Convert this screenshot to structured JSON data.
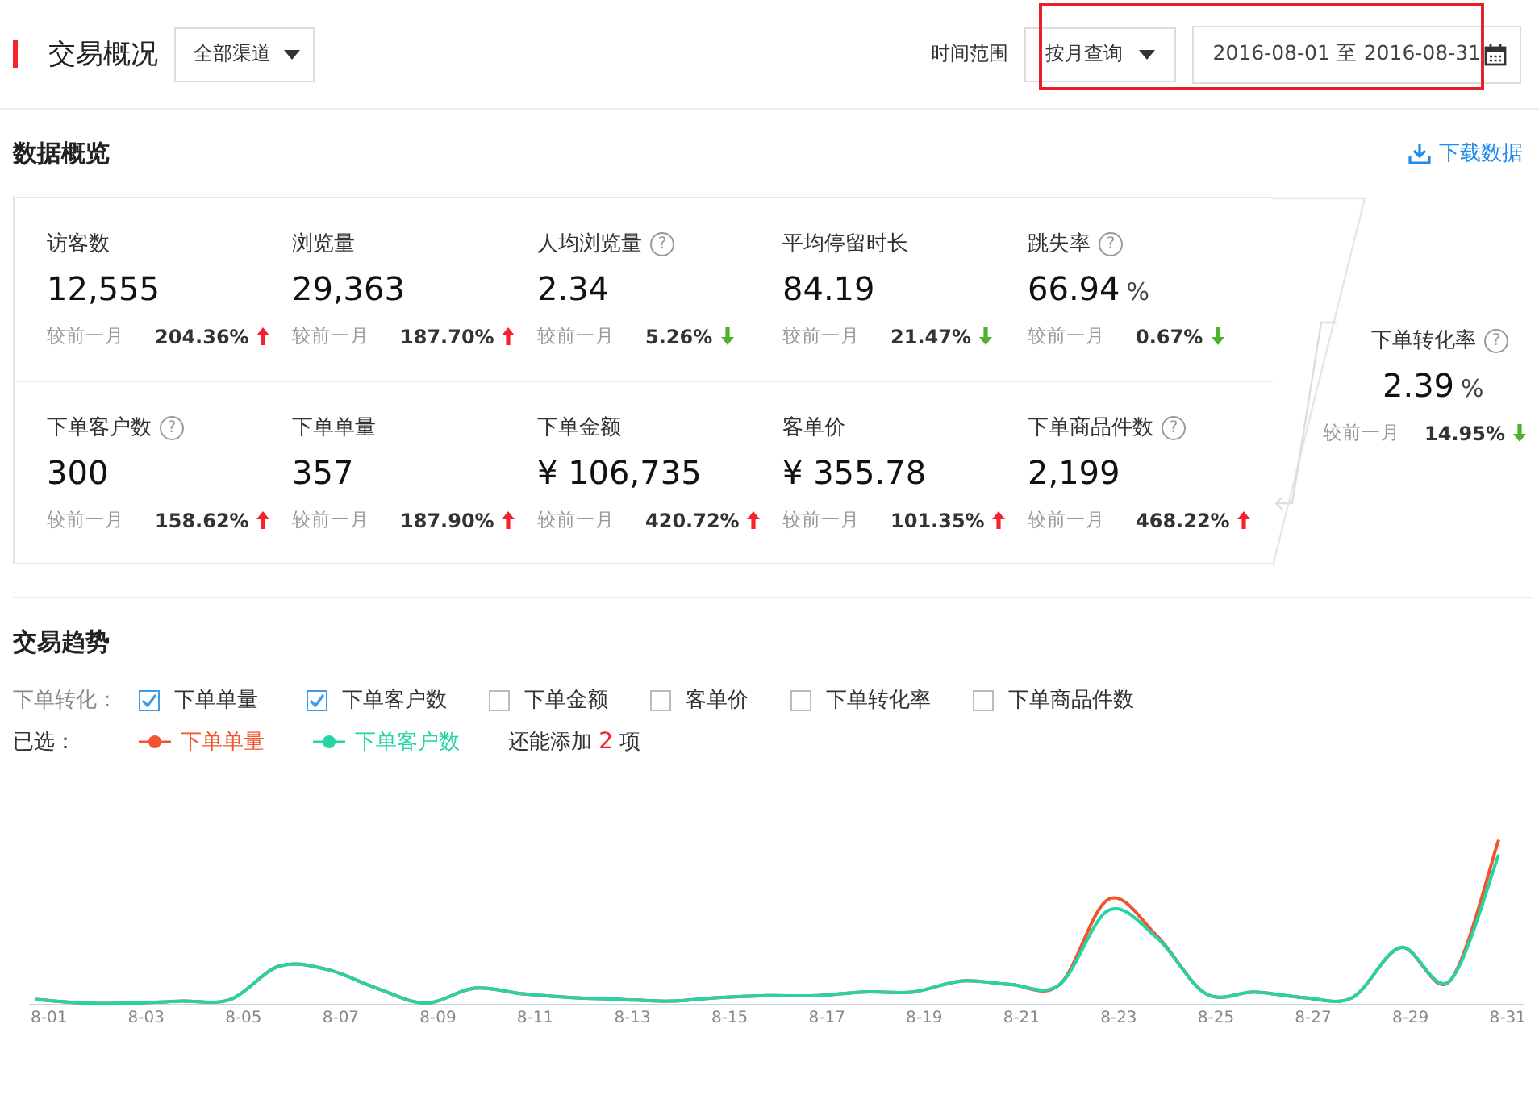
{
  "header": {
    "title": "交易概况",
    "channel": "全部渠道",
    "range_label": "时间范围",
    "range_mode": "按月查询",
    "date_range": "2016-08-01 至 2016-08-31"
  },
  "overview": {
    "title": "数据概览",
    "download": "下载数据",
    "metrics": [
      {
        "label": "访客数",
        "value": "12,555",
        "compare": "较前一月",
        "change": "204.36%",
        "increase": true
      },
      {
        "label": "浏览量",
        "value": "29,363",
        "compare": "较前一月",
        "change": "187.70%",
        "increase": true
      },
      {
        "label": "人均浏览量",
        "help": "?",
        "value": "2.34",
        "compare": "较前一月",
        "change": "5.26%",
        "increase": false
      },
      {
        "label": "平均停留时长",
        "value": "84.19",
        "compare": "较前一月",
        "change": "21.47%",
        "increase": false
      },
      {
        "label": "跳失率",
        "help": "?",
        "value": "66.94",
        "unit": "%",
        "compare": "较前一月",
        "change": "0.67%",
        "increase": false
      },
      {
        "label": "下单客户数",
        "help": "?",
        "value": "300",
        "compare": "较前一月",
        "change": "158.62%",
        "increase": true
      },
      {
        "label": "下单单量",
        "value": "357",
        "compare": "较前一月",
        "change": "187.90%",
        "increase": true
      },
      {
        "label": "下单金额",
        "value": "¥ 106,735",
        "compare": "较前一月",
        "change": "420.72%",
        "increase": true
      },
      {
        "label": "客单价",
        "value": "¥ 355.78",
        "compare": "较前一月",
        "change": "101.35%",
        "increase": true
      },
      {
        "label": "下单商品件数",
        "help": "?",
        "value": "2,199",
        "compare": "较前一月",
        "change": "468.22%",
        "increase": true
      }
    ],
    "conversion": {
      "label": "下单转化率",
      "help": "?",
      "value": "2.39",
      "unit": "%",
      "compare": "较前一月",
      "change": "14.95%",
      "increase": false
    }
  },
  "trend": {
    "title": "交易趋势",
    "filter_label": "下单转化：",
    "options": [
      {
        "label": "下单单量",
        "checked": true
      },
      {
        "label": "下单客户数",
        "checked": true
      },
      {
        "label": "下单金额",
        "checked": false
      },
      {
        "label": "客单价",
        "checked": false
      },
      {
        "label": "下单转化率",
        "checked": false
      },
      {
        "label": "下单商品件数",
        "checked": false
      }
    ],
    "selected_label": "已选：",
    "selected": [
      {
        "label": "下单单量",
        "color": "#f0552e"
      },
      {
        "label": "下单客户数",
        "color": "#25d3a4"
      }
    ],
    "remaining": {
      "before": "还能添加",
      "count": "2",
      "after": "项"
    },
    "x_labels": [
      "8-01",
      "8-03",
      "8-05",
      "8-07",
      "8-09",
      "8-11",
      "8-13",
      "8-15",
      "8-17",
      "8-19",
      "8-21",
      "8-23",
      "8-25",
      "8-27",
      "8-29",
      "8-31"
    ]
  }
}
